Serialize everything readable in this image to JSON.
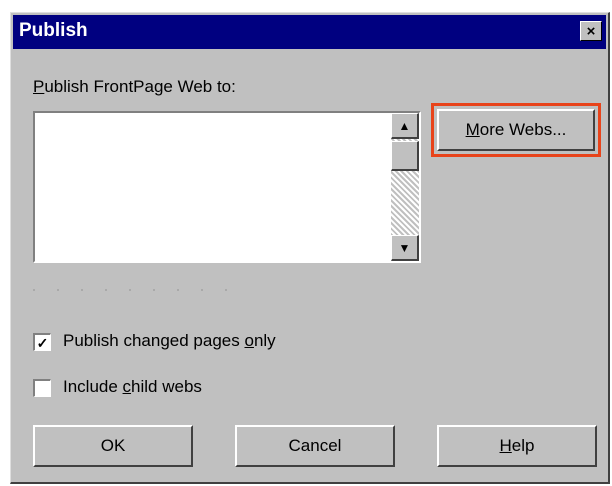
{
  "window": {
    "title": "Publish",
    "close_glyph": "×"
  },
  "publish_to": {
    "label_hotkey": "P",
    "label_rest": "ublish FrontPage Web to:",
    "list_items": []
  },
  "scrollbar": {
    "up_glyph": "▲",
    "down_glyph": "▼"
  },
  "more_webs_button": {
    "label": "More Webs...",
    "hotkey": "M",
    "highlight_color": "#e8431a"
  },
  "options": {
    "publish_changed": {
      "label_before": "Publish changed pages ",
      "hotkey": "o",
      "label_after": "nly",
      "checked": true,
      "check_glyph": "✓"
    },
    "include_child": {
      "label_before": "Include ",
      "hotkey": "c",
      "label_after": "hild webs",
      "checked": false
    }
  },
  "buttons": {
    "ok": {
      "label": "OK"
    },
    "cancel": {
      "label": "Cancel"
    },
    "help": {
      "hotkey": "H",
      "rest": "elp"
    }
  },
  "colors": {
    "titlebar": "#000080",
    "dialog_bg": "#c0c0c0"
  }
}
